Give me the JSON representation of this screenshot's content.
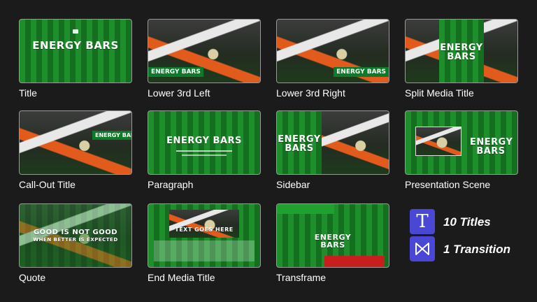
{
  "templates": [
    {
      "label": "Title",
      "brand": "ENERGY BARS"
    },
    {
      "label": "Lower 3rd Left",
      "brand": "ENERGY BARS"
    },
    {
      "label": "Lower 3rd Right",
      "brand": "ENERGY BARS"
    },
    {
      "label": "Split Media Title",
      "brand": "ENERGY BARS"
    },
    {
      "label": "Call-Out Title",
      "brand": "ENERGY BARS"
    },
    {
      "label": "Paragraph",
      "brand": "ENERGY BARS"
    },
    {
      "label": "Sidebar",
      "brand": "ENERGY BARS"
    },
    {
      "label": "Presentation Scene",
      "brand": "ENERGY BARS"
    },
    {
      "label": "Quote",
      "quote_line1": "GOOD IS NOT GOOD",
      "quote_line2": "WHEN BETTER IS EXPECTED"
    },
    {
      "label": "End Media Title",
      "heading": "TEXT GOES HERE"
    },
    {
      "label": "Transframe",
      "brand": "ENERGY BARS"
    }
  ],
  "summary": {
    "titles_count_label": "10 Titles",
    "transition_count_label": "1 Transition",
    "titles_icon_glyph": "T",
    "transition_icon": "bowtie-transition-icon"
  },
  "colors": {
    "accent_purple": "#4a47d6",
    "stripe_green_light": "#1f8f2e",
    "stripe_green_dark": "#14701f",
    "background": "#1b1b1b"
  }
}
